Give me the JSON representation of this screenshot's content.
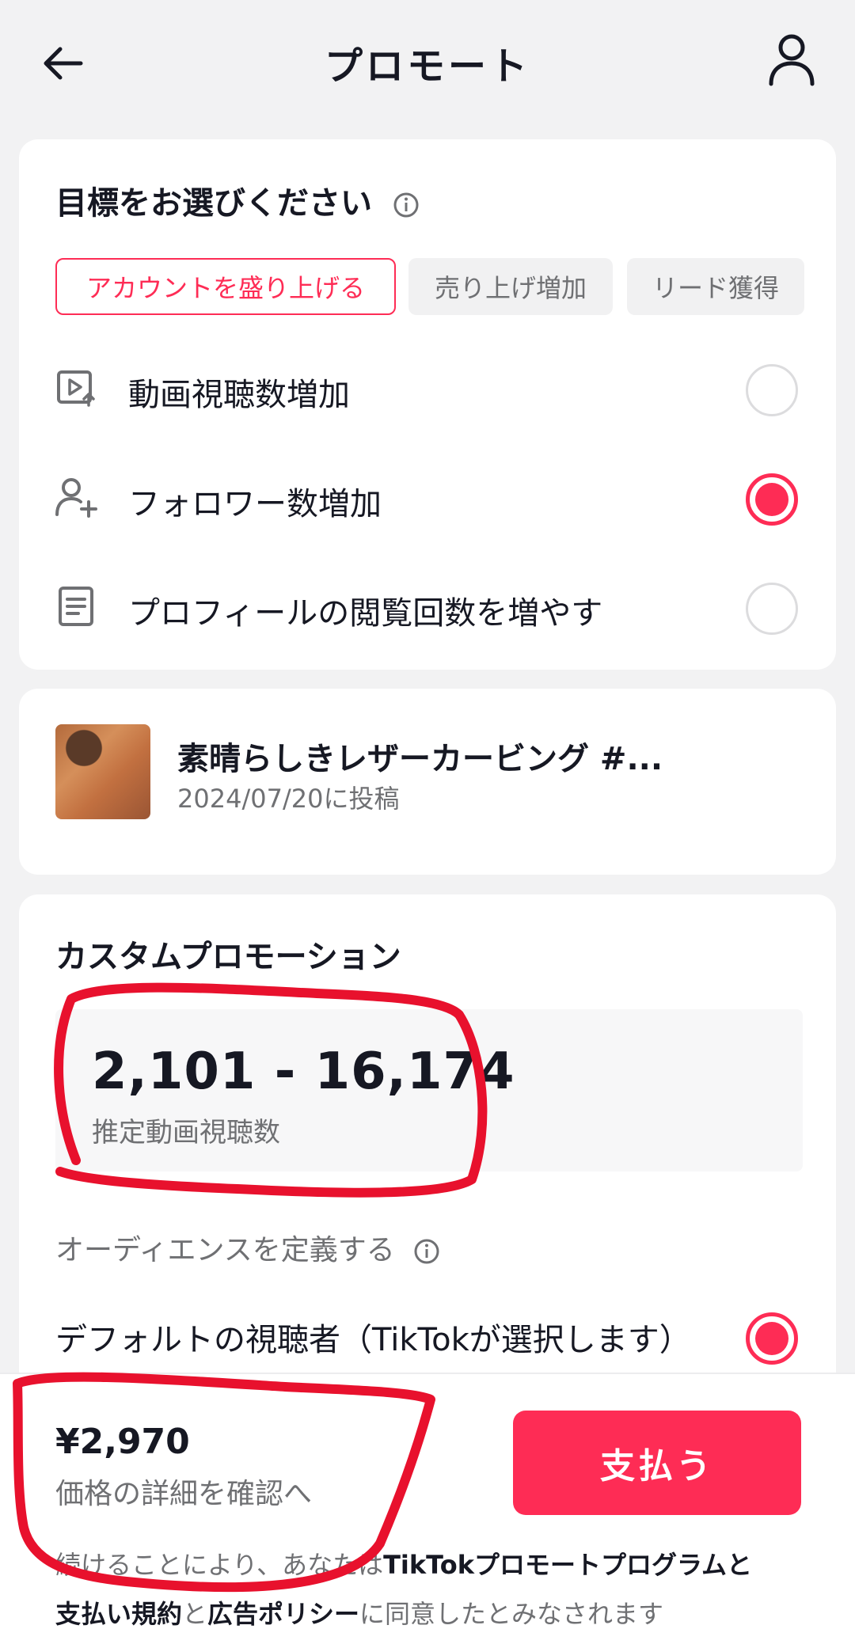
{
  "header": {
    "title": "プロモート"
  },
  "goal": {
    "title": "目標をお選びください",
    "chips": [
      "アカウントを盛り上げる",
      "売り上げ増加",
      "リード獲得"
    ],
    "options": [
      {
        "label": "動画視聴数増加",
        "checked": false,
        "icon": "video-views-icon"
      },
      {
        "label": "フォロワー数増加",
        "checked": true,
        "icon": "add-follower-icon"
      },
      {
        "label": "プロフィールの閲覧回数を増やす",
        "checked": false,
        "icon": "profile-document-icon"
      }
    ]
  },
  "video": {
    "title": "素晴らしきレザーカービング #...",
    "date": "2024/07/20に投稿"
  },
  "custom": {
    "title": "カスタムプロモーション",
    "estimate_value": "2,101 - 16,174",
    "estimate_label": "推定動画視聴数",
    "audience_title": "オーディエンスを定義する",
    "audience_option": "デフォルトの視聴者（TikTokが選択します）"
  },
  "footer": {
    "price": "¥2,970",
    "price_detail": "価格の詳細を確認へ",
    "pay_label": "支払う",
    "terms": {
      "t1": "続けることにより、あなたは",
      "l1": "TikTokプロモートプログラムと",
      "l2": "支払い規約",
      "t2": "と",
      "l3": "広告ポリシー",
      "t3": "に同意したとみなされます"
    }
  },
  "colors": {
    "accent": "#fe2c55",
    "annotation": "#e8112d",
    "background": "#f2f2f3"
  }
}
